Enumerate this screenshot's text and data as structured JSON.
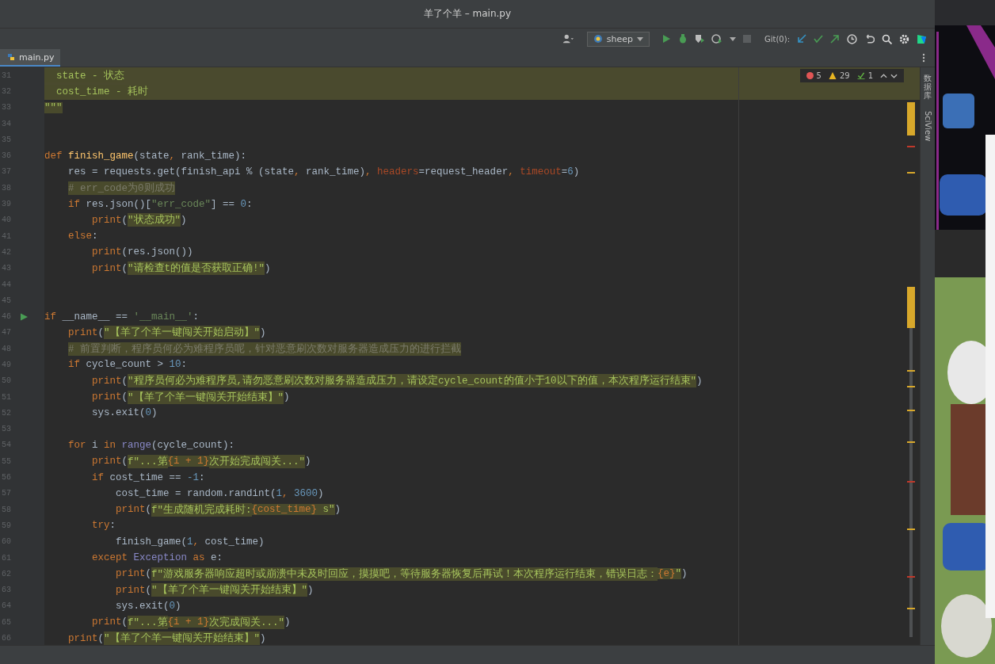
{
  "window": {
    "title": "羊了个羊 – main.py"
  },
  "toolbar": {
    "run_config": "sheep",
    "git_label": "Git(0):"
  },
  "tabs": [
    {
      "label": "main.py",
      "selected": true
    }
  ],
  "inspections": {
    "errors": "5",
    "warnings": "29",
    "weak": "1"
  },
  "side_stripe": [
    {
      "label": "数据库"
    },
    {
      "label": "SciView"
    }
  ],
  "editor": {
    "lines": [
      {
        "number": "31",
        "highlighted": true,
        "runnable": false,
        "tokens": [
          {
            "kind": "s",
            "text": "  state - 状态"
          }
        ]
      },
      {
        "number": "32",
        "highlighted": true,
        "runnable": false,
        "tokens": [
          {
            "kind": "s",
            "text": "  cost_time - 耗时"
          }
        ]
      },
      {
        "number": "33",
        "highlighted": false,
        "runnable": false,
        "tokens": [
          {
            "kind": "s",
            "text": "\"\"\""
          }
        ]
      },
      {
        "number": "34",
        "highlighted": false,
        "runnable": false
      },
      {
        "number": "35",
        "highlighted": false,
        "runnable": false
      },
      {
        "number": "36",
        "highlighted": false,
        "runnable": false,
        "tokens": [
          {
            "kind": "k",
            "text": "def "
          },
          {
            "kind": "f",
            "text": "finish_game"
          },
          {
            "kind": "p",
            "text": "(state"
          },
          {
            "kind": "k",
            "text": ","
          },
          {
            "kind": "p",
            "text": " rank_time):"
          }
        ],
        "children": [
          {
            "number": "37",
            "highlighted": false,
            "runnable": false,
            "tokens": [
              {
                "kind": "p",
                "text": "res = requests.get(finish_api % (state"
              },
              {
                "kind": "k",
                "text": ","
              },
              {
                "kind": "p",
                "text": " rank_time)"
              },
              {
                "kind": "k",
                "text": ","
              },
              {
                "kind": "a",
                "text": " headers"
              },
              {
                "kind": "p",
                "text": "=request_header"
              },
              {
                "kind": "k",
                "text": ","
              },
              {
                "kind": "a",
                "text": " timeout"
              },
              {
                "kind": "p",
                "text": "="
              },
              {
                "kind": "n",
                "text": "6"
              },
              {
                "kind": "p",
                "text": ")"
              }
            ]
          },
          {
            "number": "38",
            "highlighted": false,
            "runnable": false,
            "tokens": [
              {
                "kind": "c",
                "text": "# err_code为0则成功"
              }
            ]
          },
          {
            "number": "39",
            "highlighted": false,
            "runnable": false,
            "tokens": [
              {
                "kind": "k",
                "text": "if"
              },
              {
                "kind": "p",
                "text": " res.json()["
              },
              {
                "kind": "q",
                "text": "\"err_code\""
              },
              {
                "kind": "p",
                "text": "] == "
              },
              {
                "kind": "n",
                "text": "0"
              },
              {
                "kind": "p",
                "text": ":"
              }
            ],
            "children": [
              {
                "number": "40",
                "highlighted": false,
                "runnable": false,
                "tokens": [
                  {
                    "kind": "k",
                    "text": "print"
                  },
                  {
                    "kind": "p",
                    "text": "("
                  },
                  {
                    "kind": "s",
                    "text": "\"状态成功\""
                  },
                  {
                    "kind": "p",
                    "text": ")"
                  }
                ]
              }
            ]
          },
          {
            "number": "41",
            "highlighted": false,
            "runnable": false,
            "tokens": [
              {
                "kind": "k",
                "text": "else"
              },
              {
                "kind": "p",
                "text": ":"
              }
            ],
            "children": [
              {
                "number": "42",
                "highlighted": false,
                "runnable": false,
                "tokens": [
                  {
                    "kind": "k",
                    "text": "print"
                  },
                  {
                    "kind": "p",
                    "text": "(res.json())"
                  }
                ]
              },
              {
                "number": "43",
                "highlighted": false,
                "runnable": false,
                "tokens": [
                  {
                    "kind": "k",
                    "text": "print"
                  },
                  {
                    "kind": "p",
                    "text": "("
                  },
                  {
                    "kind": "s",
                    "text": "\"请检查t的值是否获取正确!\""
                  },
                  {
                    "kind": "p",
                    "text": ")"
                  }
                ]
              }
            ]
          }
        ]
      },
      {
        "number": "44",
        "highlighted": false,
        "runnable": false
      },
      {
        "number": "45",
        "highlighted": false,
        "runnable": false
      },
      {
        "number": "46",
        "highlighted": false,
        "runnable": true,
        "tokens": [
          {
            "kind": "k",
            "text": "if"
          },
          {
            "kind": "p",
            "text": " __name__ == "
          },
          {
            "kind": "q",
            "text": "'__main__'"
          },
          {
            "kind": "p",
            "text": ":"
          }
        ],
        "children": [
          {
            "number": "47",
            "highlighted": false,
            "runnable": false,
            "tokens": [
              {
                "kind": "k",
                "text": "print"
              },
              {
                "kind": "p",
                "text": "("
              },
              {
                "kind": "s",
                "text": "\"【羊了个羊一键闯关开始启动】\""
              },
              {
                "kind": "p",
                "text": ")"
              }
            ]
          },
          {
            "number": "48",
            "highlighted": false,
            "runnable": false,
            "tokens": [
              {
                "kind": "c",
                "text": "# 前置判断，程序员何必为难程序员呢，针对恶意刷次数对服务器造成压力的进行拦截"
              }
            ]
          },
          {
            "number": "49",
            "highlighted": false,
            "runnable": false,
            "tokens": [
              {
                "kind": "k",
                "text": "if"
              },
              {
                "kind": "p",
                "text": " cycle_count > "
              },
              {
                "kind": "n",
                "text": "10"
              },
              {
                "kind": "p",
                "text": ":"
              }
            ],
            "children": [
              {
                "number": "50",
                "highlighted": false,
                "runnable": false,
                "tokens": [
                  {
                    "kind": "k",
                    "text": "print"
                  },
                  {
                    "kind": "p",
                    "text": "("
                  },
                  {
                    "kind": "s",
                    "text": "\"程序员何必为难程序员,请勿恶意刷次数对服务器造成压力，请设定cycle_count的值小于10以下的值，本次程序运行结束\""
                  },
                  {
                    "kind": "p",
                    "text": ")"
                  }
                ]
              },
              {
                "number": "51",
                "highlighted": false,
                "runnable": false,
                "tokens": [
                  {
                    "kind": "k",
                    "text": "print"
                  },
                  {
                    "kind": "p",
                    "text": "("
                  },
                  {
                    "kind": "s",
                    "text": "\"【羊了个羊一键闯关开始结束】\""
                  },
                  {
                    "kind": "p",
                    "text": ")"
                  }
                ]
              },
              {
                "number": "52",
                "highlighted": false,
                "runnable": false,
                "tokens": [
                  {
                    "kind": "p",
                    "text": "sys.exit("
                  },
                  {
                    "kind": "n",
                    "text": "0"
                  },
                  {
                    "kind": "p",
                    "text": ")"
                  }
                ]
              }
            ]
          },
          {
            "number": "53",
            "highlighted": false,
            "runnable": false
          },
          {
            "number": "54",
            "highlighted": false,
            "runnable": false,
            "tokens": [
              {
                "kind": "k",
                "text": "for"
              },
              {
                "kind": "p",
                "text": " i "
              },
              {
                "kind": "k",
                "text": "in "
              },
              {
                "kind": "b",
                "text": "range"
              },
              {
                "kind": "p",
                "text": "(cycle_count):"
              }
            ],
            "children": [
              {
                "number": "55",
                "highlighted": false,
                "runnable": false,
                "tokens": [
                  {
                    "kind": "k",
                    "text": "print"
                  },
                  {
                    "kind": "p",
                    "text": "("
                  },
                  {
                    "kind": "s",
                    "text": "f\"...第"
                  },
                  {
                    "kind": "e",
                    "text": "{i + 1}"
                  },
                  {
                    "kind": "s",
                    "text": "次开始完成闯关...\""
                  },
                  {
                    "kind": "p",
                    "text": ")"
                  }
                ]
              },
              {
                "number": "56",
                "highlighted": false,
                "runnable": false,
                "tokens": [
                  {
                    "kind": "k",
                    "text": "if"
                  },
                  {
                    "kind": "p",
                    "text": " cost_time == "
                  },
                  {
                    "kind": "n",
                    "text": "-1"
                  },
                  {
                    "kind": "p",
                    "text": ":"
                  }
                ],
                "children": [
                  {
                    "number": "57",
                    "highlighted": false,
                    "runnable": false,
                    "tokens": [
                      {
                        "kind": "p",
                        "text": "cost_time = random.randint("
                      },
                      {
                        "kind": "n",
                        "text": "1"
                      },
                      {
                        "kind": "k",
                        "text": ","
                      },
                      {
                        "kind": "n",
                        "text": " 3600"
                      },
                      {
                        "kind": "p",
                        "text": ")"
                      }
                    ]
                  },
                  {
                    "number": "58",
                    "highlighted": false,
                    "runnable": false,
                    "tokens": [
                      {
                        "kind": "k",
                        "text": "print"
                      },
                      {
                        "kind": "p",
                        "text": "("
                      },
                      {
                        "kind": "s",
                        "text": "f\"生成随机完成耗时:"
                      },
                      {
                        "kind": "e",
                        "text": "{cost_time}"
                      },
                      {
                        "kind": "s",
                        "text": " s\""
                      },
                      {
                        "kind": "p",
                        "text": ")"
                      }
                    ]
                  }
                ]
              },
              {
                "number": "59",
                "highlighted": false,
                "runnable": false,
                "tokens": [
                  {
                    "kind": "k",
                    "text": "try"
                  },
                  {
                    "kind": "p",
                    "text": ":"
                  }
                ],
                "children": [
                  {
                    "number": "60",
                    "highlighted": false,
                    "runnable": false,
                    "tokens": [
                      {
                        "kind": "p",
                        "text": "finish_game("
                      },
                      {
                        "kind": "n",
                        "text": "1"
                      },
                      {
                        "kind": "k",
                        "text": ","
                      },
                      {
                        "kind": "p",
                        "text": " cost_time)"
                      }
                    ]
                  }
                ]
              },
              {
                "number": "61",
                "highlighted": false,
                "runnable": false,
                "tokens": [
                  {
                    "kind": "k",
                    "text": "except"
                  },
                  {
                    "kind": "b",
                    "text": " Exception"
                  },
                  {
                    "kind": "k",
                    "text": " as"
                  },
                  {
                    "kind": "p",
                    "text": " e:"
                  }
                ],
                "children": [
                  {
                    "number": "62",
                    "highlighted": false,
                    "runnable": false,
                    "tokens": [
                      {
                        "kind": "k",
                        "text": "print"
                      },
                      {
                        "kind": "p",
                        "text": "("
                      },
                      {
                        "kind": "s",
                        "text": "f\"游戏服务器响应超时或崩溃中未及时回应，摸摸吧，等待服务器恢复后再试！本次程序运行结束，错误日志："
                      },
                      {
                        "kind": "e",
                        "text": "{e}"
                      },
                      {
                        "kind": "s",
                        "text": "\""
                      },
                      {
                        "kind": "p",
                        "text": ")"
                      }
                    ]
                  },
                  {
                    "number": "63",
                    "highlighted": false,
                    "runnable": false,
                    "tokens": [
                      {
                        "kind": "k",
                        "text": "print"
                      },
                      {
                        "kind": "p",
                        "text": "("
                      },
                      {
                        "kind": "s",
                        "text": "\"【羊了个羊一键闯关开始结束】\""
                      },
                      {
                        "kind": "p",
                        "text": ")"
                      }
                    ]
                  },
                  {
                    "number": "64",
                    "highlighted": false,
                    "runnable": false,
                    "tokens": [
                      {
                        "kind": "p",
                        "text": "sys.exit("
                      },
                      {
                        "kind": "n",
                        "text": "0"
                      },
                      {
                        "kind": "p",
                        "text": ")"
                      }
                    ]
                  }
                ]
              },
              {
                "number": "65",
                "highlighted": false,
                "runnable": false,
                "tokens": [
                  {
                    "kind": "k",
                    "text": "print"
                  },
                  {
                    "kind": "p",
                    "text": "("
                  },
                  {
                    "kind": "s",
                    "text": "f\"...第"
                  },
                  {
                    "kind": "e",
                    "text": "{i + 1}"
                  },
                  {
                    "kind": "s",
                    "text": "次完成闯关...\""
                  },
                  {
                    "kind": "p",
                    "text": ")"
                  }
                ]
              }
            ]
          },
          {
            "number": "66",
            "highlighted": false,
            "runnable": false,
            "tokens": [
              {
                "kind": "k",
                "text": "print"
              },
              {
                "kind": "p",
                "text": "("
              },
              {
                "kind": "s",
                "text": "\"【羊了个羊一键闯关开始结束】\""
              },
              {
                "kind": "p",
                "text": ")"
              }
            ]
          }
        ]
      }
    ]
  }
}
